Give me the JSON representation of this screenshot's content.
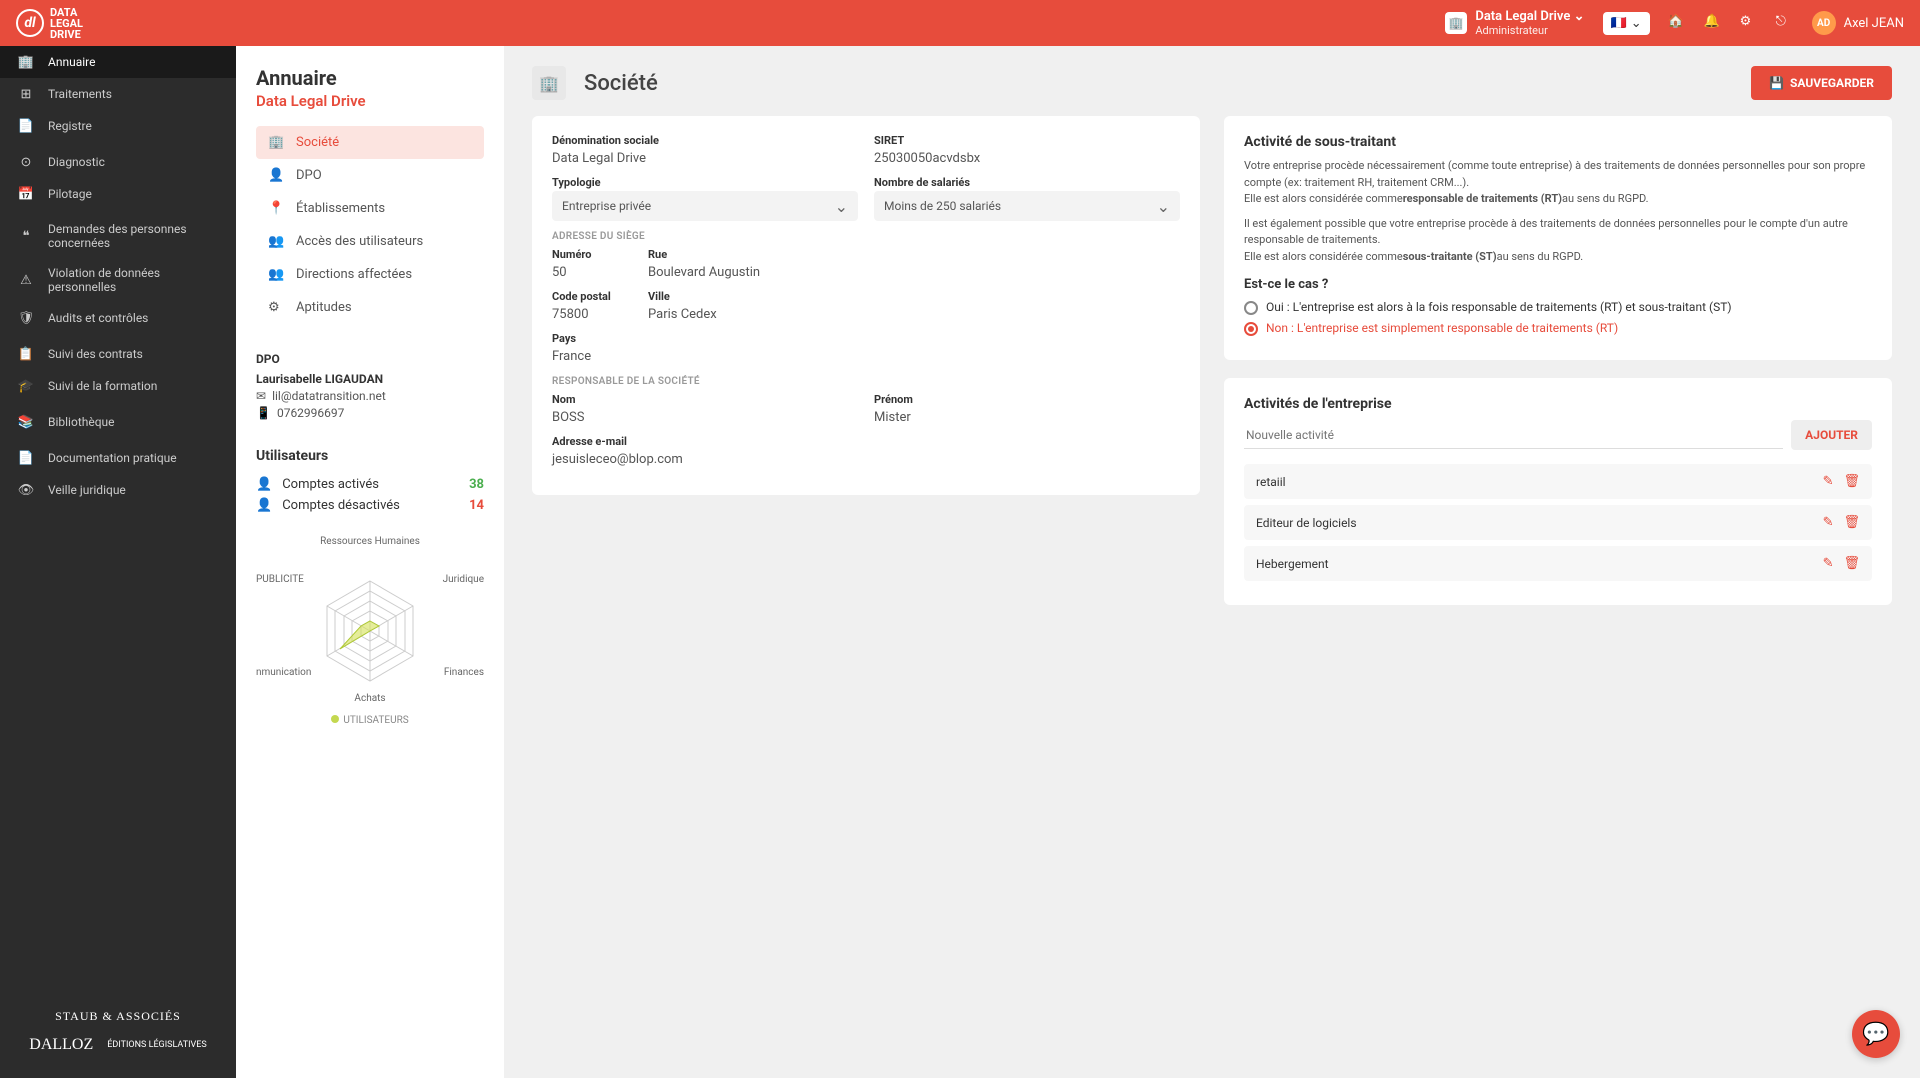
{
  "header": {
    "brand_line1": "DATA",
    "brand_line2": "LEGAL",
    "brand_line3": "DRIVE",
    "org_name": "Data Legal Drive",
    "org_role": "Administrateur",
    "user_initials": "AD",
    "user_name": "Axel JEAN"
  },
  "sidebar": {
    "groups": [
      [
        {
          "icon": "🏢",
          "label": "Annuaire",
          "active": true
        },
        {
          "icon": "⊞",
          "label": "Traitements"
        },
        {
          "icon": "📄",
          "label": "Registre"
        }
      ],
      [
        {
          "icon": "⊙",
          "label": "Diagnostic"
        },
        {
          "icon": "📅",
          "label": "Pilotage"
        }
      ],
      [
        {
          "icon": "❝",
          "label": "Demandes des personnes concernées"
        },
        {
          "icon": "⚠",
          "label": "Violation de données personnelles"
        },
        {
          "icon": "🛡",
          "label": "Audits et contrôles"
        }
      ],
      [
        {
          "icon": "📋",
          "label": "Suivi des contrats"
        },
        {
          "icon": "🎓",
          "label": "Suivi de la formation"
        }
      ],
      [
        {
          "icon": "📚",
          "label": "Bibliothèque"
        }
      ],
      [
        {
          "icon": "📄",
          "label": "Documentation pratique"
        },
        {
          "icon": "👁",
          "label": "Veille juridique"
        }
      ]
    ],
    "sponsors": [
      "STAUB & ASSOCIÉS",
      "DALLOZ",
      "ÉDITIONS LÉGISLATIVES"
    ]
  },
  "panel": {
    "title": "Annuaire",
    "company": "Data Legal Drive",
    "sub_nav": [
      {
        "icon": "🏢",
        "label": "Société",
        "active": true
      },
      {
        "icon": "👤",
        "label": "DPO"
      },
      {
        "icon": "📍",
        "label": "Établissements"
      },
      {
        "icon": "👥",
        "label": "Accès des utilisateurs"
      },
      {
        "icon": "👥",
        "label": "Directions affectées"
      },
      {
        "icon": "⚙",
        "label": "Aptitudes"
      }
    ],
    "dpo": {
      "label": "DPO",
      "name": "Laurisabelle LIGAUDAN",
      "email": "lil@datatransition.net",
      "phone": "0762996697"
    },
    "users": {
      "title": "Utilisateurs",
      "activated_label": "Comptes activés",
      "activated_count": "38",
      "deactivated_label": "Comptes désactivés",
      "deactivated_count": "14"
    },
    "radar": {
      "labels": [
        "Ressources Humaines",
        "Juridique",
        "Finances",
        "Achats",
        "nmunication",
        "PUBLICITE"
      ],
      "legend": "UTILISATEURS"
    }
  },
  "chart_data": {
    "type": "radar",
    "categories": [
      "Ressources Humaines",
      "Juridique",
      "Finances",
      "Achats",
      "Communication",
      "PUBLICITE"
    ],
    "series": [
      {
        "name": "UTILISATEURS",
        "values": [
          1,
          1,
          0,
          0,
          3,
          1
        ]
      }
    ],
    "max": 5,
    "title": "",
    "legend_position": "bottom"
  },
  "main": {
    "title": "Société",
    "save": "SAUVEGARDER",
    "fields": {
      "denom_label": "Dénomination sociale",
      "denom": "Data Legal Drive",
      "siret_label": "SIRET",
      "siret": "25030050acvdsbx",
      "typo_label": "Typologie",
      "typo": "Entreprise privée",
      "emp_label": "Nombre de salariés",
      "emp": "Moins de 250 salariés",
      "addr_sect": "ADRESSE DU SIÈGE",
      "num_label": "Numéro",
      "num": "50",
      "rue_label": "Rue",
      "rue": "Boulevard Augustin",
      "cp_label": "Code postal",
      "cp": "75800",
      "ville_label": "Ville",
      "ville": "Paris Cedex",
      "pays_label": "Pays",
      "pays": "France",
      "resp_sect": "RESPONSABLE DE LA SOCIÉTÉ",
      "nom_label": "Nom",
      "nom": "BOSS",
      "prenom_label": "Prénom",
      "prenom": "Mister",
      "email_label": "Adresse e-mail",
      "email": "jesuisleceo@blop.com"
    },
    "subproc": {
      "title": "Activité de sous-traitant",
      "p1a": "Votre entreprise procède nécessairement (comme toute entreprise) à des traitements de données personnelles pour son propre compte (ex: traitement RH, traitement CRM...).",
      "p1b": "Elle est alors considérée comme",
      "p1c": "responsable de traitements (RT)",
      "p1d": "au sens du RGPD.",
      "p2a": "Il est également possible que votre entreprise procède à des traitements de données personnelles pour le compte d'un autre responsable de traitements.",
      "p2b": "Elle est alors considérée comme",
      "p2c": "sous-traitante (ST)",
      "p2d": "au sens du RGPD.",
      "q": "Est-ce le cas ?",
      "opt_yes": "Oui : L'entreprise est alors à la fois responsable de traitements (RT) et sous-traitant (ST)",
      "opt_no": "Non : L'entreprise est simplement responsable de traitements (RT)"
    },
    "activities": {
      "title": "Activités de l'entreprise",
      "placeholder": "Nouvelle activité",
      "add": "AJOUTER",
      "items": [
        "retaiil",
        "Editeur de logiciels",
        "Hebergement"
      ]
    }
  }
}
